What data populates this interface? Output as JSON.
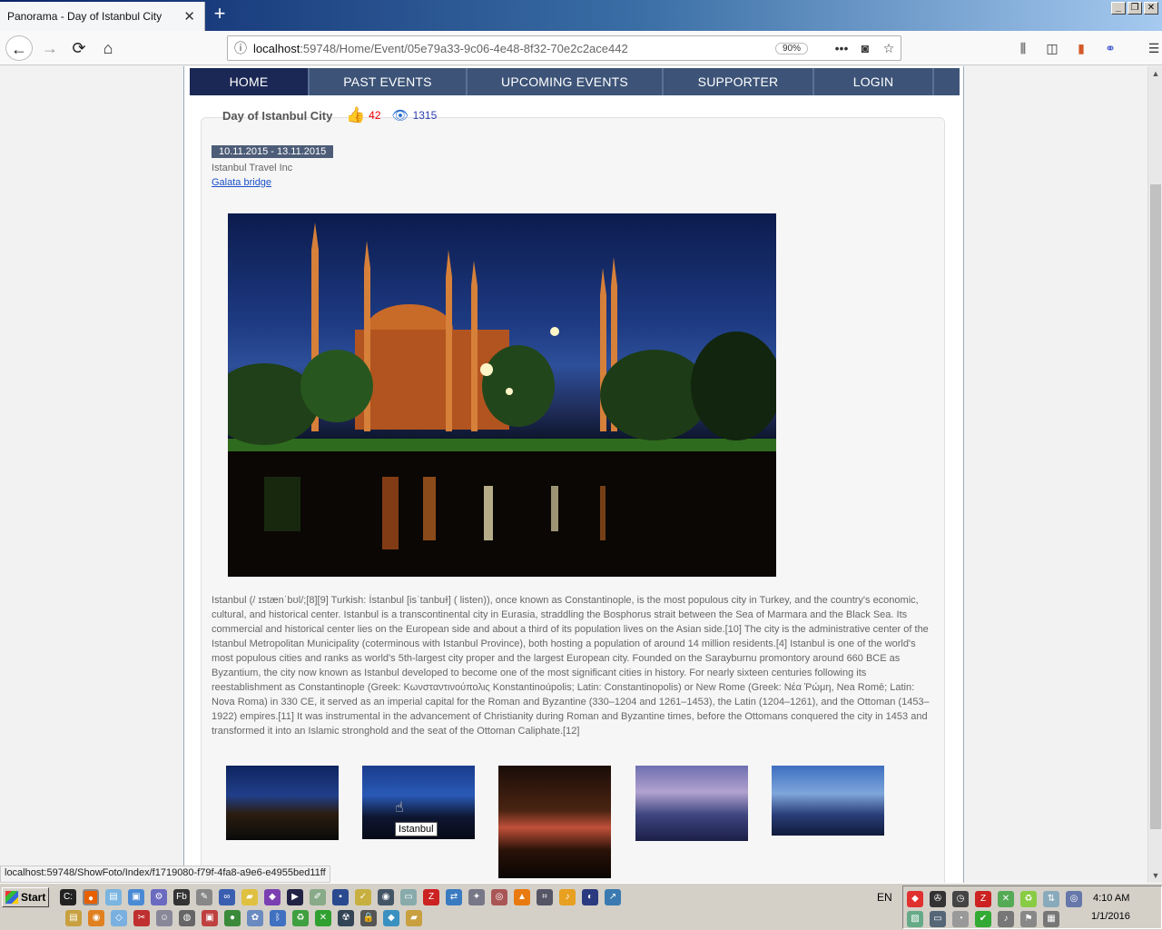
{
  "browser": {
    "tab_title": "Panorama - Day of Istanbul City",
    "tab_close": "✕",
    "new_tab": "+",
    "url_host": "localhost",
    "url_path": ":59748/Home/Event/05e79a33-9c06-4e48-8f32-70e2c2ace442",
    "zoom": "90%",
    "status_url": "localhost:59748/ShowFoto/Index/f1719080-f79f-4fa8-a9e6-e4955bed11ff"
  },
  "menu": {
    "items": [
      {
        "label": "HOME"
      },
      {
        "label": "PAST EVENTS"
      },
      {
        "label": "UPCOMING EVENTS"
      },
      {
        "label": "SUPPORTER"
      },
      {
        "label": "LOGIN"
      }
    ]
  },
  "event": {
    "title": "Day of Istanbul City",
    "likes": "42",
    "views": "1315",
    "date_range": "10.11.2015 - 13.11.2015",
    "organizer": "Istanbul Travel Inc",
    "location": "Galata bridge",
    "description": "Istanbul (/ ɪstænˈbʊl/;[8][9] Turkish: İstanbul [isˈtanbuɫ] ( listen)), once known as Constantinople, is the most populous city in Turkey, and the country's economic, cultural, and historical center. Istanbul is a transcontinental city in Eurasia, straddling the Bosphorus strait between the Sea of Marmara and the Black Sea. Its commercial and historical center lies on the European side and about a third of its population lives on the Asian side.[10] The city is the administrative center of the Istanbul Metropolitan Municipality (coterminous with Istanbul Province), both hosting a population of around 14 million residents.[4] Istanbul is one of the world's most populous cities and ranks as world's 5th-largest city proper and the largest European city. Founded on the Sarayburnu promontory around 660 BCE as Byzantium, the city now known as Istanbul developed to become one of the most significant cities in history. For nearly sixteen centuries following its reestablishment as Constantinople (Greek: Κωνσταντινούπολις Konstantinoúpolis; Latin: Constantinopolis) or New Rome (Greek: Νέα Ῥώμη, Nea Romē; Latin: Nova Roma) in 330 CE, it served as an imperial capital for the Roman and Byzantine (330–1204 and 1261–1453), the Latin (1204–1261), and the Ottoman (1453–1922) empires.[11] It was instrumental in the advancement of Christianity during Roman and Byzantine times, before the Ottomans conquered the city in 1453 and transformed it into an Islamic stronghold and the seat of the Ottoman Caliphate.[12]",
    "tooltip": "Istanbul"
  },
  "taskbar": {
    "start": "Start",
    "lang": "EN",
    "time": "4:10 AM",
    "date": "1/1/2016"
  },
  "colors": {
    "menu_bg": "#3d5478",
    "menu_active": "#1b2855",
    "like_red": "#e00000",
    "view_blue": "#2a3fb0",
    "link_blue": "#1a4fc9"
  }
}
